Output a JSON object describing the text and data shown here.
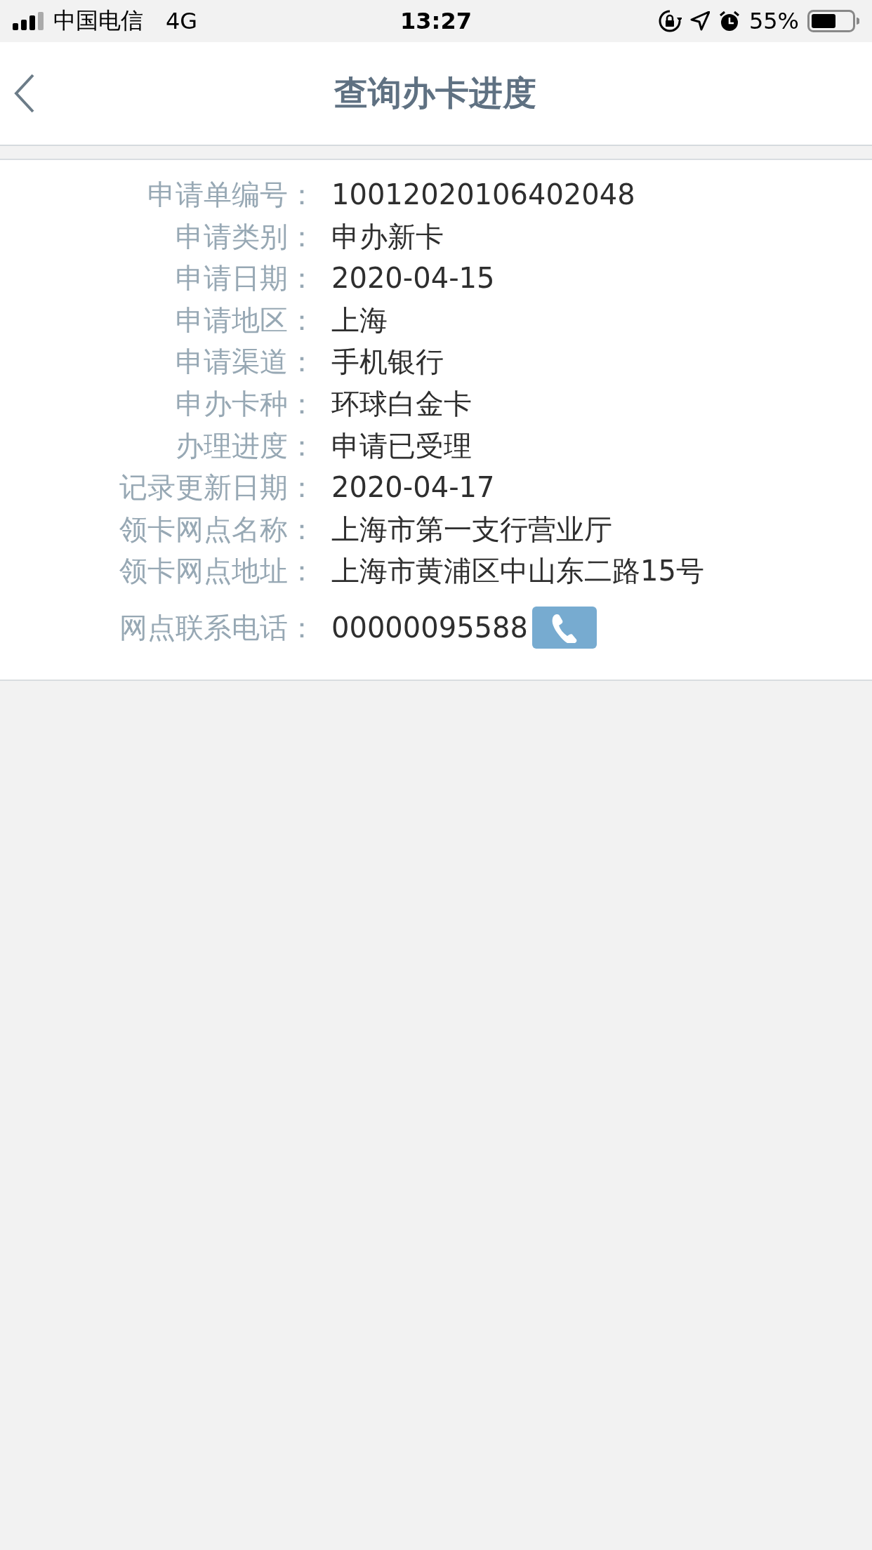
{
  "status_bar": {
    "carrier": "中国电信",
    "network": "4G",
    "time": "13:27",
    "battery": "55%"
  },
  "nav": {
    "title": "查询办卡进度"
  },
  "details": [
    {
      "label": "申请单编号：",
      "value": "10012020106402048",
      "kind": "text"
    },
    {
      "label": "申请类别：",
      "value": "申办新卡",
      "kind": "text"
    },
    {
      "label": "申请日期：",
      "value": "2020-04-15",
      "kind": "text"
    },
    {
      "label": "申请地区：",
      "value": "上海",
      "kind": "text"
    },
    {
      "label": "申请渠道：",
      "value": "手机银行",
      "kind": "text"
    },
    {
      "label": "申办卡种：",
      "value": "环球白金卡",
      "kind": "text"
    },
    {
      "label": "办理进度：",
      "value": "申请已受理",
      "kind": "text"
    },
    {
      "label": "记录更新日期：",
      "value": "2020-04-17",
      "kind": "text"
    },
    {
      "label": "领卡网点名称：",
      "value": "上海市第一支行营业厅",
      "kind": "text"
    },
    {
      "label": "领卡网点地址：",
      "value": "上海市黄浦区中山东二路15号",
      "kind": "text"
    },
    {
      "label": "网点联系电话：",
      "value": "00000095588",
      "kind": "phone"
    }
  ]
}
